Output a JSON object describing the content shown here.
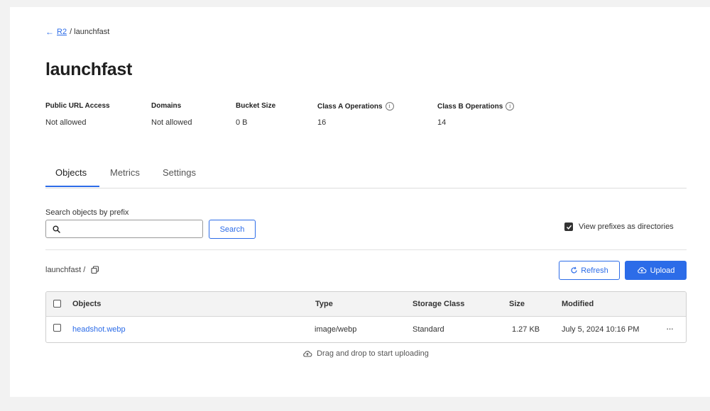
{
  "breadcrumb": {
    "root": "R2",
    "current": "/ launchfast"
  },
  "title": "launchfast",
  "stats": [
    {
      "label": "Public URL Access",
      "value": "Not allowed",
      "info": false
    },
    {
      "label": "Domains",
      "value": "Not allowed",
      "info": false
    },
    {
      "label": "Bucket Size",
      "value": "0 B",
      "info": false
    },
    {
      "label": "Class A Operations",
      "value": "16",
      "info": true
    },
    {
      "label": "Class B Operations",
      "value": "14",
      "info": true
    }
  ],
  "tabs": [
    {
      "label": "Objects",
      "active": true
    },
    {
      "label": "Metrics",
      "active": false
    },
    {
      "label": "Settings",
      "active": false
    }
  ],
  "search": {
    "label": "Search objects by prefix",
    "value": "",
    "placeholder": "",
    "button": "Search"
  },
  "view_prefixes": {
    "label": "View prefixes as directories",
    "checked": true
  },
  "path": "launchfast /",
  "buttons": {
    "refresh": "Refresh",
    "upload": "Upload"
  },
  "table": {
    "columns": [
      "Objects",
      "Type",
      "Storage Class",
      "Size",
      "Modified"
    ],
    "rows": [
      {
        "name": "headshot.webp",
        "type": "image/webp",
        "storage_class": "Standard",
        "size": "1.27 KB",
        "modified": "July 5, 2024 10:16 PM",
        "menu": "···"
      }
    ]
  },
  "dropzone": "Drag and drop to start uploading",
  "colors": {
    "accent": "#2c6ce8",
    "background": "#f2f2f2",
    "panel": "#ffffff"
  }
}
